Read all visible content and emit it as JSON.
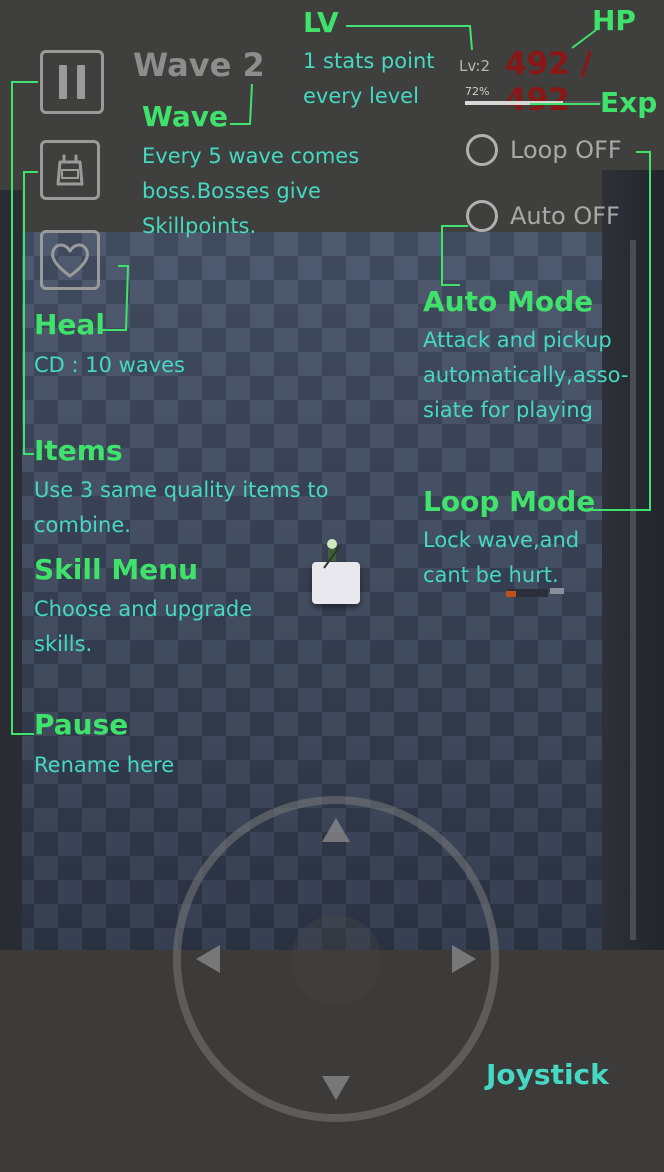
{
  "hud": {
    "wave_label": "Wave 2",
    "lv_label": "Lv:2",
    "hp_label": "492 / 492",
    "exp_label": "72%",
    "exp_fraction": 0.72,
    "loop_toggle": "Loop OFF",
    "auto_toggle": "Auto OFF"
  },
  "annotations": {
    "lv": {
      "title": "LV",
      "desc": "1 stats point every level"
    },
    "hp": {
      "title": "HP"
    },
    "exp": {
      "title": "Exp"
    },
    "wave": {
      "title": "Wave",
      "desc": "Every 5 wave comes boss.Bosses give Skillpoints."
    },
    "heal": {
      "title": "Heal",
      "desc": "CD : 10 waves"
    },
    "items": {
      "title": "Items",
      "desc": "Use 3 same quality items to combine."
    },
    "skill_menu": {
      "title": "Skill Menu",
      "desc": "Choose and upgrade skills."
    },
    "pause": {
      "title": "Pause",
      "desc": "Rename here"
    },
    "auto_mode": {
      "title": "Auto Mode",
      "desc": "Attack and pickup automatically,asso-siate for playing"
    },
    "loop_mode": {
      "title": "Loop Mode",
      "desc": "Lock wave,and cant be hurt."
    },
    "joystick": {
      "title": "Joystick"
    }
  },
  "colors": {
    "annotation_title": "#3fe26a",
    "annotation_body": "#45d9c4",
    "hp_color": "#8a1616",
    "hud_gray": "#9a9a9a"
  },
  "icons": {
    "pause": "pause-icon",
    "items": "bag-icon",
    "heal": "heart-icon"
  }
}
